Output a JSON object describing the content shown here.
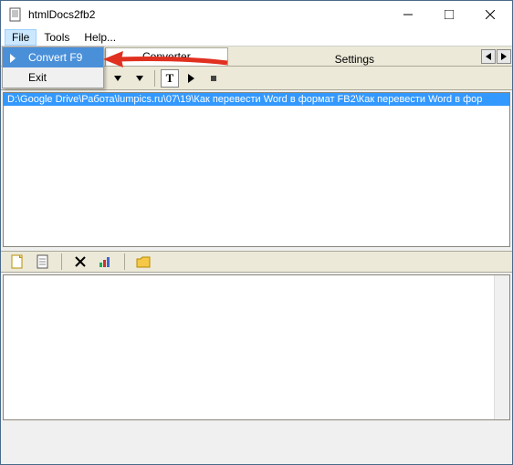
{
  "window": {
    "title": "htmlDocs2fb2"
  },
  "menu": {
    "file": "File",
    "tools": "Tools",
    "help": "Help..."
  },
  "dropdown": {
    "convert": "Convert F9",
    "exit": "Exit"
  },
  "tabs": {
    "converter": "Converter",
    "settings": "Settings"
  },
  "list": {
    "row0": "D:\\Google Drive\\Работа\\lumpics.ru\\07\\19\\Как перевести Word в формат FB2\\Как перевести Word в фор"
  },
  "icons": {
    "app": "document-icon",
    "min": "minimize-icon",
    "max": "maximize-icon",
    "close": "close-icon"
  }
}
